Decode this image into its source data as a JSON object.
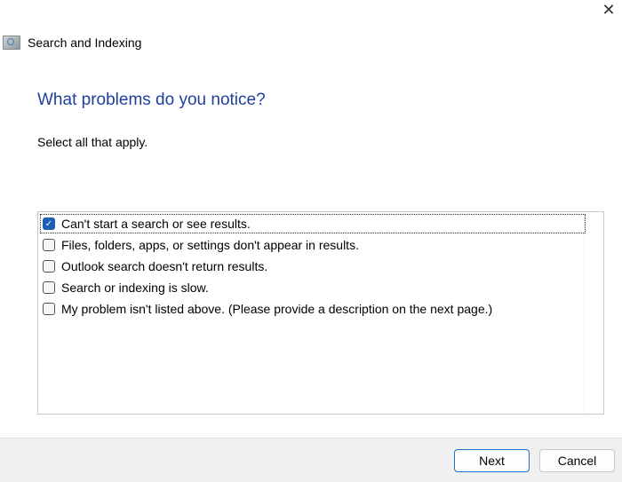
{
  "window": {
    "title": "Search and Indexing",
    "close_icon": "close-icon",
    "app_icon": "search-indexing-icon"
  },
  "main": {
    "heading": "What problems do you notice?",
    "instruction": "Select all that apply.",
    "options": [
      {
        "label": "Can't start a search or see results.",
        "checked": true
      },
      {
        "label": "Files, folders, apps, or settings don't appear in results.",
        "checked": false
      },
      {
        "label": "Outlook search doesn't return results.",
        "checked": false
      },
      {
        "label": "Search or indexing is slow.",
        "checked": false
      },
      {
        "label": "My problem isn't listed above. (Please provide a description on the next page.)",
        "checked": false
      }
    ]
  },
  "footer": {
    "next_label": "Next",
    "cancel_label": "Cancel"
  },
  "colors": {
    "heading": "#1f3f9c",
    "accent": "#1a5fb4"
  }
}
